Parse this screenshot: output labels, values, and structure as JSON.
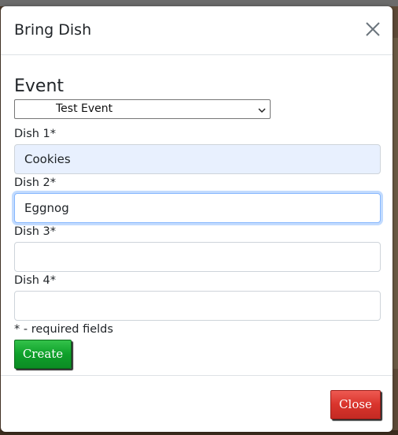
{
  "modal": {
    "title": "Bring Dish",
    "close_icon": "close-x-icon"
  },
  "form": {
    "event_label": "Event",
    "event_selected": "Test Event",
    "fields": [
      {
        "label": "Dish 1*",
        "value": "Cookies",
        "state": "autofilled"
      },
      {
        "label": "Dish 2*",
        "value": "Eggnog",
        "state": "focused"
      },
      {
        "label": "Dish 3*",
        "value": "",
        "state": "empty"
      },
      {
        "label": "Dish 4*",
        "value": "",
        "state": "empty"
      }
    ],
    "required_note": "* - required fields",
    "create_label": "Create"
  },
  "footer": {
    "close_label": "Close"
  },
  "colors": {
    "create_button": "#0ea02a",
    "close_button": "#d9342c",
    "autofill_bg": "#e8f0fe",
    "focus_border": "#86b7fe"
  }
}
